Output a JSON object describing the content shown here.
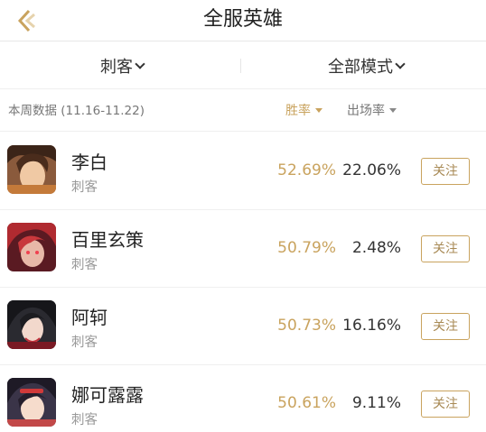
{
  "header": {
    "title": "全服英雄",
    "back_icon": "back-chevron-icon",
    "accent": "#c9a35e"
  },
  "filters": {
    "role": "刺客",
    "mode": "全部模式"
  },
  "subbar": {
    "week_label": "本周数据 (11.16-11.22)",
    "win_rate_label": "胜率",
    "pick_rate_label": "出场率"
  },
  "heroes": [
    {
      "name": "李白",
      "role": "刺客",
      "win_rate": "52.69%",
      "pick_rate": "22.06%",
      "follow": "关注"
    },
    {
      "name": "百里玄策",
      "role": "刺客",
      "win_rate": "50.79%",
      "pick_rate": "2.48%",
      "follow": "关注"
    },
    {
      "name": "阿轲",
      "role": "刺客",
      "win_rate": "50.73%",
      "pick_rate": "16.16%",
      "follow": "关注"
    },
    {
      "name": "娜可露露",
      "role": "刺客",
      "win_rate": "50.61%",
      "pick_rate": "9.11%",
      "follow": "关注"
    }
  ]
}
